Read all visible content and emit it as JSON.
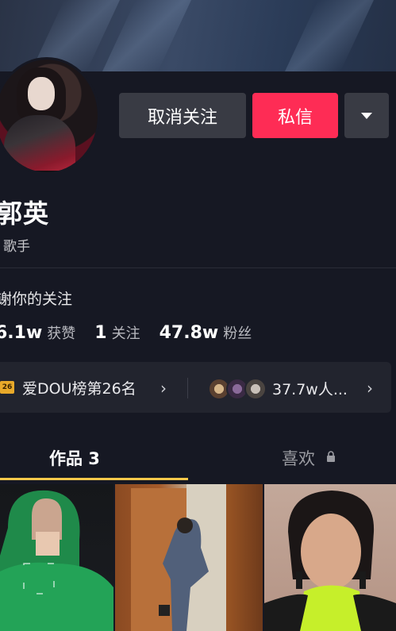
{
  "header": {
    "unfollow_label": "取消关注",
    "message_label": "私信",
    "dropdown_icon": "caret-down-icon"
  },
  "profile": {
    "name": "郭英",
    "tag": "歌手",
    "bio": "谢你的关注"
  },
  "stats": [
    {
      "value": "6.1w",
      "label": "获赞"
    },
    {
      "value": "1",
      "label": "关注"
    },
    {
      "value": "47.8w",
      "label": "粉丝"
    }
  ],
  "promo": {
    "badge": "26",
    "rank_text": "爱DOU榜第26名",
    "count_text": "37.7w人..."
  },
  "tabs": {
    "works": "作品 3",
    "likes": "喜欢"
  },
  "colors": {
    "background": "#161823",
    "accent_red": "#fe2c55",
    "tab_underline": "#f5c84a"
  }
}
